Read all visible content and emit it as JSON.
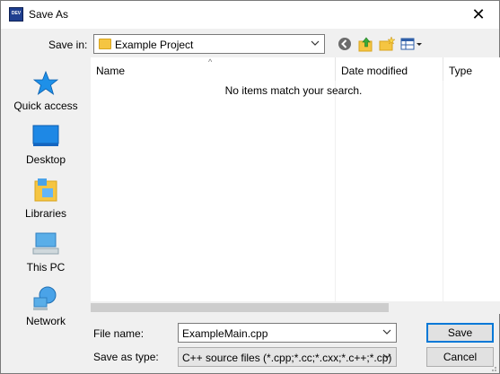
{
  "window": {
    "title": "Save As",
    "close_glyph": "✕"
  },
  "toolbar": {
    "save_in_label": "Save in:",
    "save_in_value": "Example Project",
    "icons": [
      "back-icon",
      "up-folder-icon",
      "new-folder-icon",
      "view-menu-icon"
    ]
  },
  "places": [
    {
      "label": "Quick access",
      "icon": "quick-access-star-icon"
    },
    {
      "label": "Desktop",
      "icon": "desktop-icon"
    },
    {
      "label": "Libraries",
      "icon": "libraries-icon"
    },
    {
      "label": "This PC",
      "icon": "this-pc-icon"
    },
    {
      "label": "Network",
      "icon": "network-icon"
    }
  ],
  "file_list": {
    "columns": [
      "Name",
      "Date modified",
      "Type"
    ],
    "sort_indicator": "^",
    "empty_message": "No items match your search."
  },
  "form": {
    "file_name_label": "File name:",
    "file_name_value": "ExampleMain.cpp",
    "save_type_label": "Save as type:",
    "save_type_value": "C++ source files (*.cpp;*.cc;*.cxx;*.c++;*.cp)"
  },
  "buttons": {
    "save": "Save",
    "cancel": "Cancel"
  },
  "colors": {
    "accent": "#0078d7",
    "folder": "#f5c542",
    "dialog_bg": "#f0f0f0"
  }
}
